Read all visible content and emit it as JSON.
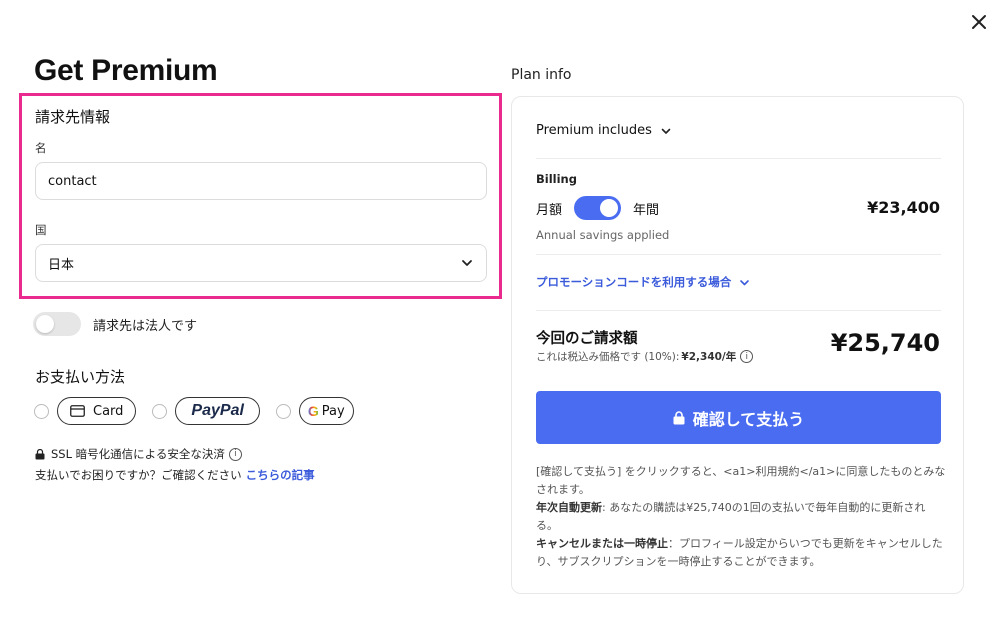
{
  "page": {
    "title": "Get Premium"
  },
  "billing_info": {
    "section_title": "請求先情報",
    "name_label": "名",
    "name_value": "contact",
    "country_label": "国",
    "country_value": "日本"
  },
  "corporate_toggle": {
    "label": "請求先は法人です",
    "on": false
  },
  "payment": {
    "title": "お支払い方法",
    "options": [
      {
        "label": "Card",
        "icon": "card-icon"
      },
      {
        "label": "PayPal"
      },
      {
        "label": "Pay",
        "prefix": "G"
      }
    ],
    "ssl_text": "SSL 暗号化通信による安全な決済",
    "help_text": "支払いでお困りですか？ご確認ください",
    "help_link": "こちらの記事"
  },
  "plan": {
    "info_title": "Plan info",
    "includes_label": "Premium includes",
    "billing_label": "Billing",
    "monthly_label": "月額",
    "yearly_label": "年間",
    "yearly_selected": true,
    "billing_price": "¥23,400",
    "savings_text": "Annual savings applied",
    "promo_text": "プロモーションコードを利用する場合",
    "total_label": "今回のご請求額",
    "tax_text": "これは税込み価格です (10%):",
    "tax_amount": "¥2,340/年",
    "total_price": "¥25,740",
    "pay_button": "確認して支払う",
    "terms_1": "[確認して支払う] をクリックすると、<a1>利用規約</a1>に同意したものとみなされます。",
    "terms_2_bold": "年次自動更新",
    "terms_2": ": あなたの購読は¥25,740の1回の支払いで毎年自動的に更新される。",
    "terms_3_bold": "キャンセルまたは一時停止",
    "terms_3": "：プロフィール設定からいつでも更新をキャンセルしたり、サブスクリプションを一時停止することができます。"
  },
  "colors": {
    "highlight": "#ea2a8f",
    "accent": "#4a6cf0",
    "link": "#3b5bdb"
  }
}
